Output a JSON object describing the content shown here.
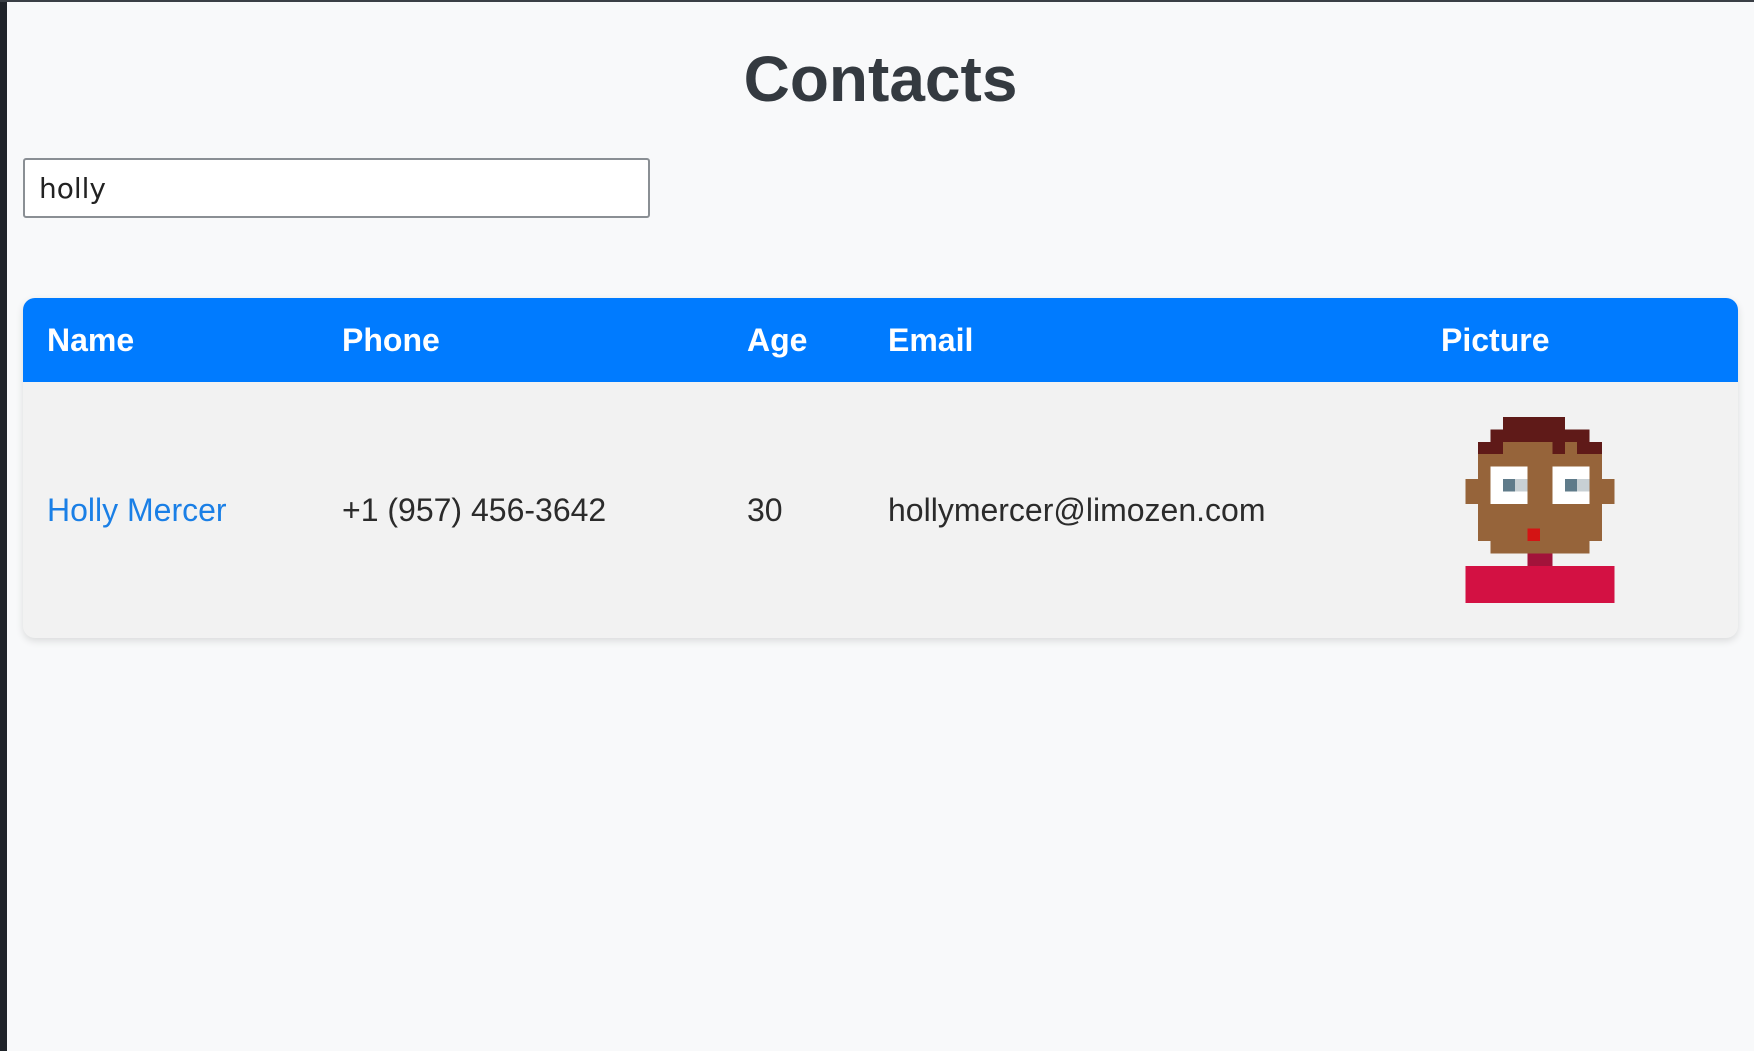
{
  "page": {
    "title": "Contacts"
  },
  "search": {
    "value": "holly"
  },
  "table": {
    "headers": {
      "name": "Name",
      "phone": "Phone",
      "age": "Age",
      "email": "Email",
      "picture": "Picture"
    },
    "rows": [
      {
        "name": "Holly Mercer",
        "phone": "+1 (957) 456-3642",
        "age": "30",
        "email": "hollymercer@limozen.com",
        "picture_icon": "pixel-avatar-icon"
      }
    ]
  },
  "colors": {
    "header_bg": "#007bff",
    "link": "#1a7fe6",
    "title": "#343a40",
    "avatar_skin": "#96643a",
    "avatar_hair": "#5f1a18",
    "avatar_shirt": "#d31143"
  }
}
